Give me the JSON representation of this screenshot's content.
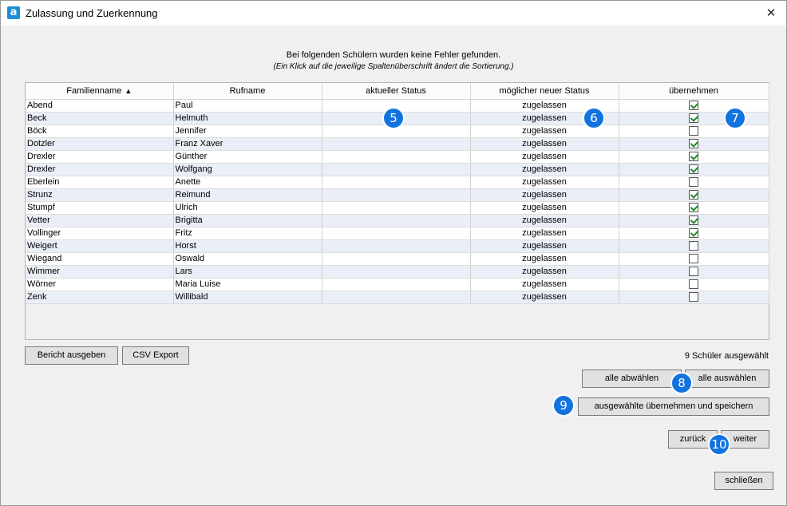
{
  "window": {
    "app_icon_letter": "a",
    "title": "Zulassung und Zuerkennung",
    "close_glyph": "✕"
  },
  "messages": {
    "line1": "Bei folgenden Schülern wurden keine Fehler gefunden.",
    "line2": "(Ein Klick auf die jeweilige Spaltenüberschrift ändert die Sortierung.)"
  },
  "table": {
    "columns": [
      "Familienname",
      "Rufname",
      "aktueller Status",
      "möglicher neuer Status",
      "übernehmen"
    ],
    "sort_indicator": "▲",
    "rows": [
      {
        "family": "Abend",
        "first": "Paul",
        "current": "",
        "new": "zugelassen",
        "take": true
      },
      {
        "family": "Beck",
        "first": "Helmuth",
        "current": "",
        "new": "zugelassen",
        "take": true
      },
      {
        "family": "Böck",
        "first": "Jennifer",
        "current": "",
        "new": "zugelassen",
        "take": false
      },
      {
        "family": "Dotzler",
        "first": "Franz Xaver",
        "current": "",
        "new": "zugelassen",
        "take": true
      },
      {
        "family": "Drexler",
        "first": "Günther",
        "current": "",
        "new": "zugelassen",
        "take": true
      },
      {
        "family": "Drexler",
        "first": "Wolfgang",
        "current": "",
        "new": "zugelassen",
        "take": true
      },
      {
        "family": "Eberlein",
        "first": "Anette",
        "current": "",
        "new": "zugelassen",
        "take": false
      },
      {
        "family": "Strunz",
        "first": "Reimund",
        "current": "",
        "new": "zugelassen",
        "take": true
      },
      {
        "family": "Stumpf",
        "first": "Ulrich",
        "current": "",
        "new": "zugelassen",
        "take": true
      },
      {
        "family": "Vetter",
        "first": "Brigitta",
        "current": "",
        "new": "zugelassen",
        "take": true
      },
      {
        "family": "Vollinger",
        "first": "Fritz",
        "current": "",
        "new": "zugelassen",
        "take": true
      },
      {
        "family": "Weigert",
        "first": "Horst",
        "current": "",
        "new": "zugelassen",
        "take": false
      },
      {
        "family": "Wiegand",
        "first": "Oswald",
        "current": "",
        "new": "zugelassen",
        "take": false
      },
      {
        "family": "Wimmer",
        "first": "Lars",
        "current": "",
        "new": "zugelassen",
        "take": false
      },
      {
        "family": "Wörner",
        "first": "Maria Luise",
        "current": "",
        "new": "zugelassen",
        "take": false
      },
      {
        "family": "Zenk",
        "first": "Willibald",
        "current": "",
        "new": "zugelassen",
        "take": false
      }
    ]
  },
  "buttons": {
    "report": "Bericht ausgeben",
    "csv": "CSV Export",
    "deselect_all": "alle abwählen",
    "select_all": "alle auswählen",
    "apply_save": "ausgewählte übernehmen und speichern",
    "back": "zurück",
    "next": "weiter",
    "close": "schließen"
  },
  "status": {
    "selected_count": "9 Schüler ausgewählt"
  },
  "badges": [
    "5",
    "6",
    "7",
    "8",
    "9",
    "10"
  ],
  "colors": {
    "badge": "#1273de",
    "check": "#1e8a2a",
    "row_alt": "#e9eef7"
  }
}
